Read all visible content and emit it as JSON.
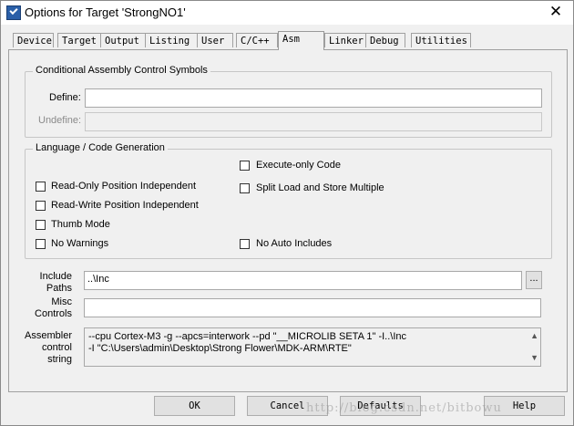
{
  "window": {
    "title": "Options for Target 'StrongNO1'",
    "close": "✕"
  },
  "tabs": [
    "Device",
    "Target",
    "Output",
    "Listing",
    "User",
    "C/C++",
    "Asm",
    "Linker",
    "Debug",
    "Utilities"
  ],
  "active_tab": "Asm",
  "conditional": {
    "title": "Conditional Assembly Control Symbols",
    "define_label": "Define:",
    "define_value": "",
    "undefine_label": "Undefine:",
    "undefine_value": ""
  },
  "language": {
    "title": "Language / Code Generation",
    "read_only": "Read-Only Position Independent",
    "read_write": "Read-Write Position Independent",
    "thumb": "Thumb Mode",
    "no_warnings": "No Warnings",
    "execute_only": "Execute-only Code",
    "split_load": "Split Load and Store Multiple",
    "no_auto": "No Auto Includes",
    "checked": {
      "read_only": false,
      "read_write": false,
      "thumb": false,
      "no_warnings": false,
      "execute_only": false,
      "split_load": false,
      "no_auto": false
    }
  },
  "include": {
    "label1": "Include",
    "label2": "Paths",
    "value": "..\\Inc",
    "browse": "..."
  },
  "misc": {
    "label1": "Misc",
    "label2": "Controls",
    "value": ""
  },
  "asm": {
    "label1": "Assembler",
    "label2": "control",
    "label3": "string",
    "line1": "--cpu Cortex-M3 -g --apcs=interwork --pd \"__MICROLIB SETA 1\" -I..\\Inc",
    "line2": "-I \"C:\\Users\\admin\\Desktop\\Strong Flower\\MDK-ARM\\RTE\""
  },
  "buttons": {
    "ok": "OK",
    "cancel": "Cancel",
    "defaults": "Defaults",
    "help": "Help"
  },
  "watermark": "http://blog.csdn.net/bitbowu"
}
